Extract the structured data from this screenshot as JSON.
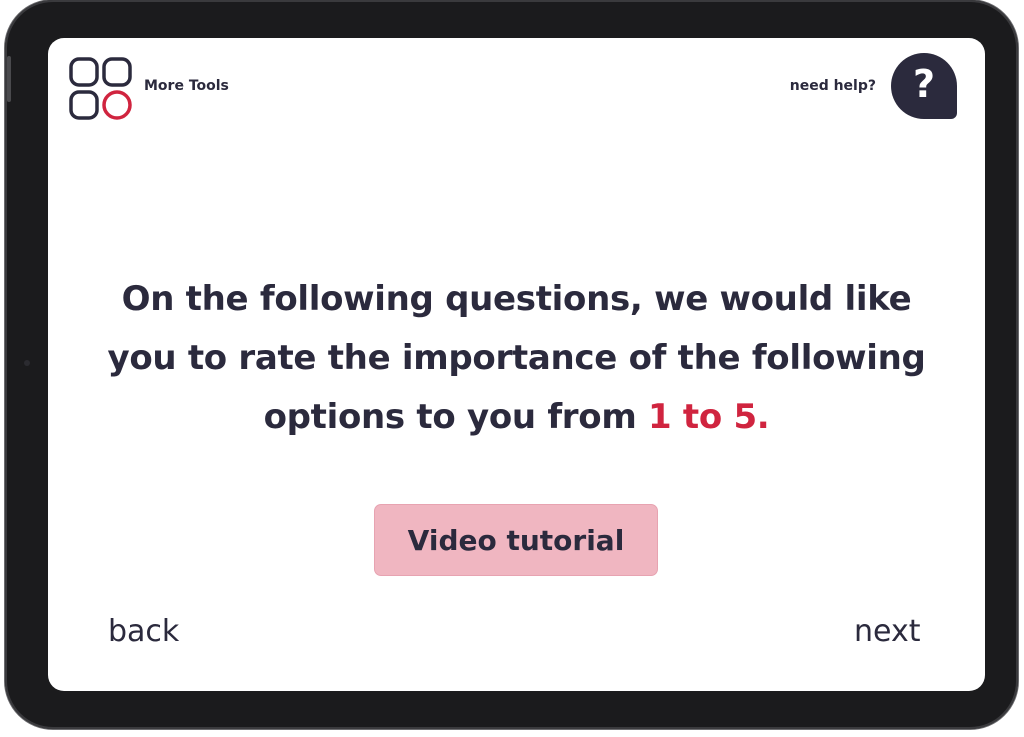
{
  "header": {
    "tools_label": "More Tools",
    "help_label": "need help?",
    "help_icon_text": "?"
  },
  "main": {
    "question_text": "On the following questions, we would like you to rate the importance of the following options to you from ",
    "question_highlight": "1 to 5.",
    "video_button_label": "Video tutorial"
  },
  "footer": {
    "back_label": "back",
    "next_label": "next"
  },
  "colors": {
    "primary_text": "#2b2a3d",
    "accent_red": "#d0243f",
    "button_pink": "#f0b6c1",
    "device_frame": "#1b1b1d"
  },
  "icons": {
    "tools": "grid-tools-icon",
    "help": "question-mark-icon"
  }
}
